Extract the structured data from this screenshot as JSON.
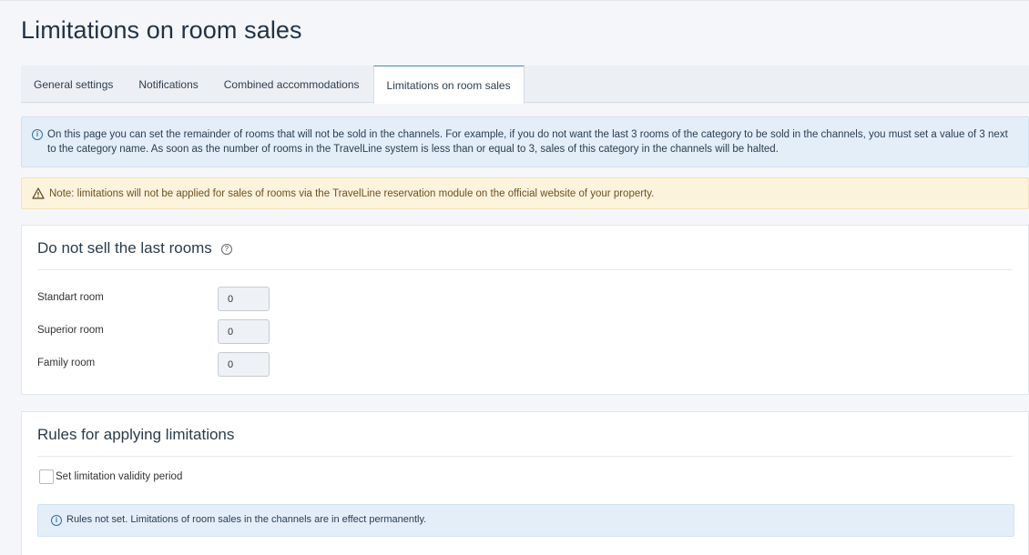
{
  "page": {
    "title": "Limitations on room sales"
  },
  "tabs": [
    {
      "label": "General settings",
      "active": false
    },
    {
      "label": "Notifications",
      "active": false
    },
    {
      "label": "Combined accommodations",
      "active": false
    },
    {
      "label": "Limitations on room sales",
      "active": true
    }
  ],
  "info_alert": {
    "icon": "info-icon",
    "text": "On this page you can set the remainder of rooms that will not be sold in the channels. For example, if you do not want the last 3 rooms of the category to be sold in the channels, you must set a value of 3 next to the category name. As soon as the number of rooms in the TravelLine system is less than or equal to 3, sales of this category in the channels will be halted."
  },
  "warning_alert": {
    "icon": "warning-icon",
    "text": "Note: limitations will not be applied for sales of rooms via the TravelLine reservation module on the official website of your property."
  },
  "last_rooms": {
    "title": "Do not sell the last rooms",
    "help_icon": "help-icon",
    "rooms": [
      {
        "label": "Standart room",
        "value": "0"
      },
      {
        "label": "Superior room",
        "value": "0"
      },
      {
        "label": "Family room",
        "value": "0"
      }
    ]
  },
  "rules": {
    "title": "Rules for applying limitations",
    "checkbox_label": "Set limitation validity period",
    "checkbox_checked": false,
    "notice_icon": "info-icon",
    "notice_text": "Rules not set. Limitations of room sales in the channels are in effect permanently."
  },
  "colors": {
    "accent": "#3b87c8",
    "info_bg": "#e3eef9",
    "warning_bg": "#fcf3dc",
    "page_bg": "#f4f6f9"
  }
}
